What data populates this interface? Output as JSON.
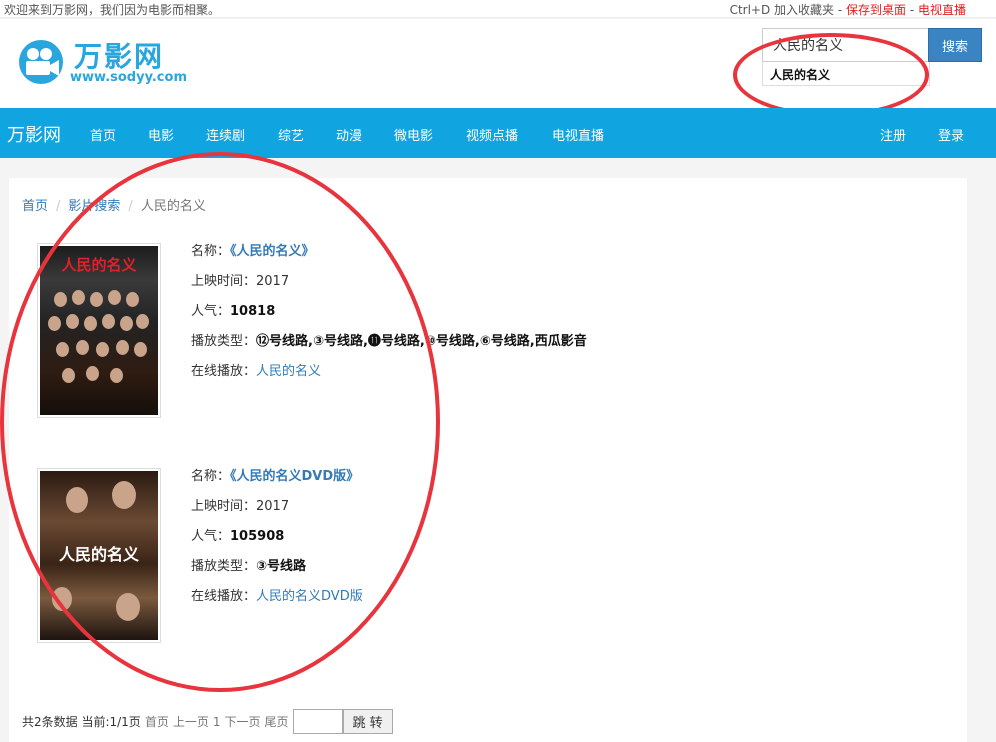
{
  "topbar": {
    "welcome": "欢迎来到万影网，我们因为电影而相聚。",
    "bookmark_hint": "Ctrl+D 加入收藏夹 - ",
    "save_desktop": "保存到桌面",
    "dash": " - ",
    "live_tv": "电视直播"
  },
  "logo": {
    "title": "万影网",
    "url": "www.sodyy.com"
  },
  "search": {
    "value": "人民的名义",
    "button_label": "搜索",
    "suggestion": "人民的名义"
  },
  "nav": {
    "brand": "万影网",
    "items": [
      "首页",
      "电影",
      "连续剧",
      "综艺",
      "动漫",
      "微电影",
      "视频点播",
      "电视直播"
    ],
    "register": "注册",
    "login": "登录"
  },
  "breadcrumb": {
    "home": "首页",
    "search": "影片搜索",
    "current": "人民的名义"
  },
  "results": [
    {
      "poster_text": "人民的名义",
      "name_label": "名称：",
      "name": "《人民的名义》",
      "release_label": "上映时间：",
      "release": "2017",
      "popularity_label": "人气：",
      "popularity": "10818",
      "type_label": "播放类型：",
      "types": "⑫号线路,③号线路,⓫号线路,⑩号线路,⑥号线路,西瓜影音",
      "online_label": "在线播放：",
      "online": "人民的名义"
    },
    {
      "poster_text": "人民的名义",
      "name_label": "名称：",
      "name": "《人民的名义DVD版》",
      "release_label": "上映时间：",
      "release": "2017",
      "popularity_label": "人气：",
      "popularity": "105908",
      "type_label": "播放类型：",
      "types": "③号线路",
      "online_label": "在线播放：",
      "online": "人民的名义DVD版"
    }
  ],
  "pager": {
    "total": "共2条数据 当前:1/1页",
    "first": "首页",
    "prev": "上一页",
    "page": "1",
    "next": "下一页",
    "last": "尾页",
    "jump": "跳 转"
  },
  "colors": {
    "nav_bg": "#10a5e0",
    "link": "#337ab7",
    "annotation": "#e8343c",
    "search_button": "#3a84c4"
  }
}
